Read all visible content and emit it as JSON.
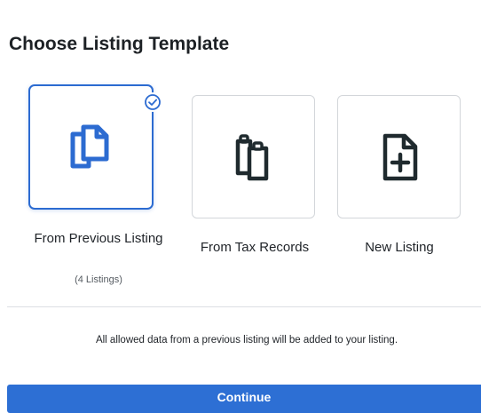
{
  "header": {
    "title": "Choose Listing Template"
  },
  "templates": [
    {
      "label": "From Previous Listing",
      "sublabel": "(4 Listings)",
      "icon": "copy-documents-icon",
      "selected": true
    },
    {
      "label": "From Tax Records",
      "icon": "clipboards-icon",
      "selected": false
    },
    {
      "label": "New Listing",
      "icon": "new-document-plus-icon",
      "selected": false
    }
  ],
  "info_text": "All allowed data from a previous listing will be added to your listing.",
  "continue_label": "Continue",
  "colors": {
    "accent": "#2d6fd4",
    "selected_border": "#2c6bd1",
    "icon_dark": "#1f2a2e",
    "card_border": "#d3d6da"
  }
}
